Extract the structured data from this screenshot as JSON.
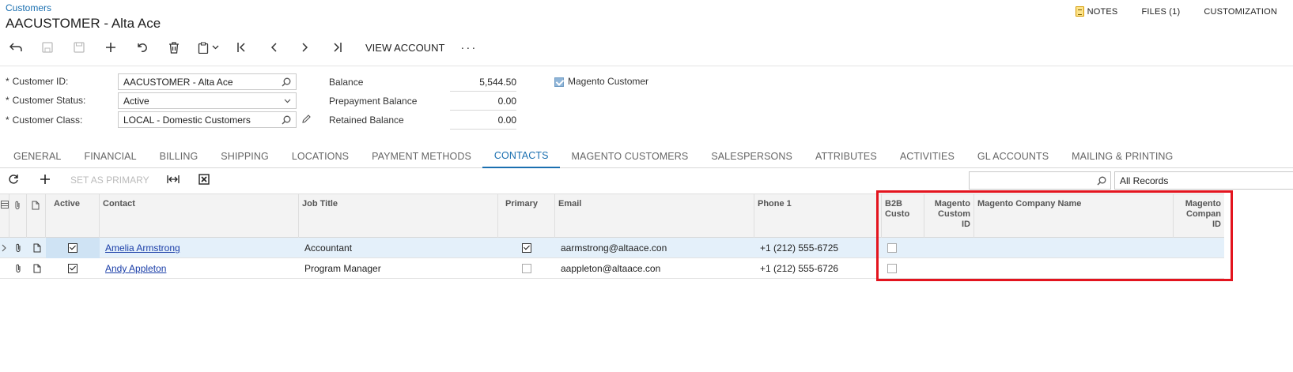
{
  "header": {
    "breadcrumb": "Customers",
    "title": "AACUSTOMER - Alta Ace",
    "links": {
      "notes": "NOTES",
      "files": "FILES (1)",
      "customization": "CUSTOMIZATION"
    }
  },
  "toolbar": {
    "view_account": "VIEW ACCOUNT",
    "more": "···"
  },
  "form": {
    "customer_id_label": "Customer ID:",
    "customer_id_value": "AACUSTOMER - Alta Ace",
    "customer_status_label": "Customer Status:",
    "customer_status_value": "Active",
    "customer_class_label": "Customer Class:",
    "customer_class_value": "LOCAL - Domestic Customers",
    "required_mark": "*",
    "balance_label": "Balance",
    "balance_value": "5,544.50",
    "prepayment_label": "Prepayment Balance",
    "prepayment_value": "0.00",
    "retained_label": "Retained Balance",
    "retained_value": "0.00",
    "magento_customer_label": "Magento Customer",
    "magento_customer_checked": true
  },
  "tabs": [
    "GENERAL",
    "FINANCIAL",
    "BILLING",
    "SHIPPING",
    "LOCATIONS",
    "PAYMENT METHODS",
    "CONTACTS",
    "MAGENTO CUSTOMERS",
    "SALESPERSONS",
    "ATTRIBUTES",
    "ACTIVITIES",
    "GL ACCOUNTS",
    "MAILING & PRINTING"
  ],
  "active_tab": "CONTACTS",
  "grid_toolbar": {
    "set_as_primary": "SET AS PRIMARY",
    "filter_value": "All Records"
  },
  "columns": {
    "active": "Active",
    "contact": "Contact",
    "job_title": "Job Title",
    "primary": "Primary",
    "email": "Email",
    "phone": "Phone 1",
    "b2b_line1": "B2B",
    "b2b_line2": "Custo",
    "mag_cust_id_line1": "Magento",
    "mag_cust_id_line2": "Custom",
    "mag_cust_id_line3": "ID",
    "mag_company_name": "Magento Company Name",
    "mag_company_id_line1": "Magento",
    "mag_company_id_line2": "Compan",
    "mag_company_id_line3": "ID"
  },
  "rows": [
    {
      "active": true,
      "contact": "Amelia Armstrong",
      "job_title": "Accountant",
      "primary": true,
      "email": "aarmstrong@altaace.con",
      "phone": "+1 (212) 555-6725",
      "b2b": false
    },
    {
      "active": true,
      "contact": "Andy Appleton",
      "job_title": "Program Manager",
      "primary": false,
      "email": "aappleton@altaace.con",
      "phone": "+1 (212) 555-6726",
      "b2b": false
    }
  ],
  "colors": {
    "accent": "#1a6fb0",
    "highlight_box": "#e3141e",
    "link": "#1a3ea8",
    "selected_row": "#e4f0fa"
  }
}
